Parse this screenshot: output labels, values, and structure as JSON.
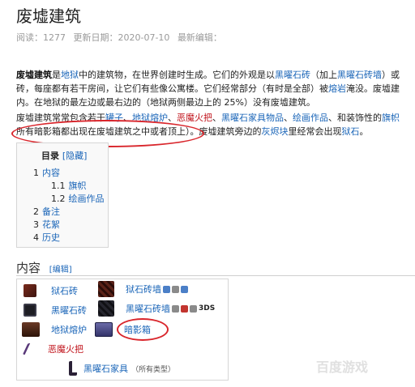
{
  "page": {
    "title": "废墟建筑",
    "meta": {
      "reads": "阅读：1277",
      "updated": "更新日期：2020-07-10",
      "editors": "最新编辑："
    }
  },
  "intro": {
    "line1": [
      {
        "t": "废墟建筑",
        "s": "b"
      },
      {
        "t": "是",
        "s": ""
      },
      {
        "t": "地狱",
        "s": "lnk"
      },
      {
        "t": "中的建筑物，在世界创建时生成。它们的外观是以",
        "s": ""
      },
      {
        "t": "黑曜石砖",
        "s": "lnk"
      },
      {
        "t": "（加上",
        "s": ""
      },
      {
        "t": "黑曜石砖墙",
        "s": "lnk"
      },
      {
        "t": "）或",
        "s": ""
      }
    ],
    "line2": [
      {
        "t": "砖，每座都有若干房间，让它们有些像公寓楼。它们经常部分（有时是全部）被",
        "s": ""
      },
      {
        "t": "熔岩",
        "s": "lnk"
      },
      {
        "t": "淹没。废墟建",
        "s": ""
      }
    ],
    "line3": [
      {
        "t": "内。在地狱的最左边或最右边的（地狱两侧最边上的 25%）没有废墟建筑。",
        "s": ""
      }
    ]
  },
  "contents_para": {
    "line1": [
      {
        "t": "废墟建筑常常包含若干",
        "s": ""
      },
      {
        "t": "罐子",
        "s": "lnk"
      },
      {
        "t": "、",
        "s": ""
      },
      {
        "t": "地狱熔炉",
        "s": "lnk"
      },
      {
        "t": "、",
        "s": ""
      },
      {
        "t": "恶魔火把",
        "s": "red"
      },
      {
        "t": "、",
        "s": ""
      },
      {
        "t": "黑曜石家具物品",
        "s": "lnk"
      },
      {
        "t": "、",
        "s": ""
      },
      {
        "t": "绘画作品",
        "s": "lnk"
      },
      {
        "t": "、和装饰性的",
        "s": ""
      },
      {
        "t": "旗帜",
        "s": "lnk"
      }
    ],
    "line2": [
      {
        "t": "所有暗影箱都出现在废墟建筑之中或者顶上）。废墟建筑旁边的",
        "s": ""
      },
      {
        "t": "灰烬块",
        "s": "lnk"
      },
      {
        "t": "里经常会出现",
        "s": ""
      },
      {
        "t": "狱石",
        "s": "lnk"
      },
      {
        "t": "。",
        "s": ""
      }
    ]
  },
  "toc": {
    "title": "目录",
    "hide": "[隐藏]",
    "items": [
      {
        "num": "1",
        "label": "内容"
      },
      {
        "num": "1.1",
        "label": "旗帜"
      },
      {
        "num": "1.2",
        "label": "绘画作品"
      },
      {
        "num": "2",
        "label": "备注"
      },
      {
        "num": "3",
        "label": "花絮"
      },
      {
        "num": "4",
        "label": "历史"
      }
    ]
  },
  "section": {
    "heading": "内容",
    "edit": "[编辑]"
  },
  "navbox": {
    "items": [
      {
        "icon": "hellstone-brick-icon",
        "label": "狱石砖",
        "color": "#1a65b8"
      },
      {
        "icon": "hellstone-brick-wall-icon",
        "label": "狱石砖墙",
        "color": "#1a65b8"
      },
      {
        "icon": "obsidian-brick-icon",
        "label": "黑曜石砖",
        "color": "#1a65b8"
      },
      {
        "icon": "obsidian-brick-wall-icon",
        "label": "黑曜石砖墙",
        "color": "#1a65b8",
        "platform": "3DS"
      },
      {
        "icon": "hellforge-icon",
        "label": "地狱熔炉",
        "color": "#1a65b8"
      },
      {
        "icon": "shadow-chest-icon",
        "label": "暗影箱",
        "color": "#1a65b8"
      },
      {
        "icon": "demon-torch-icon",
        "label": "恶魔火把",
        "color": "#c0121a"
      },
      {
        "icon": "obsidian-chair-icon",
        "label": "黑曜石家具",
        "color": "#1a65b8",
        "note": "（所有类型）"
      }
    ]
  },
  "watermark": "百度游戏"
}
